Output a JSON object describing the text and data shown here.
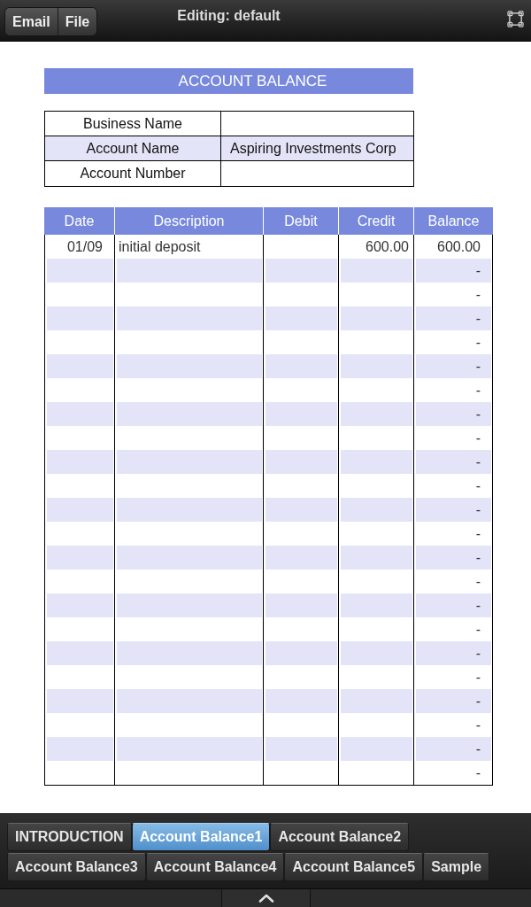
{
  "top_bar": {
    "buttons": [
      {
        "label": "Email"
      },
      {
        "label": "File"
      }
    ],
    "title": "Editing: default"
  },
  "sheet": {
    "title": "ACCOUNT BALANCE",
    "info": [
      {
        "label": "Business Name"
      },
      {
        "label": "Account Name",
        "value": "Aspiring Investments Corp"
      },
      {
        "label": "Account Number"
      }
    ]
  },
  "ledger": {
    "columns": [
      "Date",
      "Description",
      "Debit",
      "Credit",
      "Balance"
    ],
    "rows": [
      {
        "date": "01/09",
        "description": "initial deposit",
        "credit": "600.00",
        "balance": "600.00"
      },
      {
        "balance": "-"
      },
      {
        "balance": "-"
      },
      {
        "balance": "-"
      },
      {
        "balance": "-"
      },
      {
        "balance": "-"
      },
      {
        "balance": "-"
      },
      {
        "balance": "-"
      },
      {
        "balance": "-"
      },
      {
        "balance": "-"
      },
      {
        "balance": "-"
      },
      {
        "balance": "-"
      },
      {
        "balance": "-"
      },
      {
        "balance": "-"
      },
      {
        "balance": "-"
      },
      {
        "balance": "-"
      },
      {
        "balance": "-"
      },
      {
        "balance": "-"
      },
      {
        "balance": "-"
      },
      {
        "balance": "-"
      },
      {
        "balance": "-"
      },
      {
        "balance": "-"
      },
      {
        "balance": "-"
      }
    ]
  },
  "sheet_tabs": [
    {
      "label": "INTRODUCTION",
      "selected": false
    },
    {
      "label": "Account Balance1",
      "selected": true
    },
    {
      "label": "Account Balance2",
      "selected": false
    },
    {
      "label": "Account Balance3",
      "selected": false
    },
    {
      "label": "Account Balance4",
      "selected": false
    },
    {
      "label": "Account Balance5",
      "selected": false
    },
    {
      "label": "Sample",
      "selected": false
    }
  ]
}
